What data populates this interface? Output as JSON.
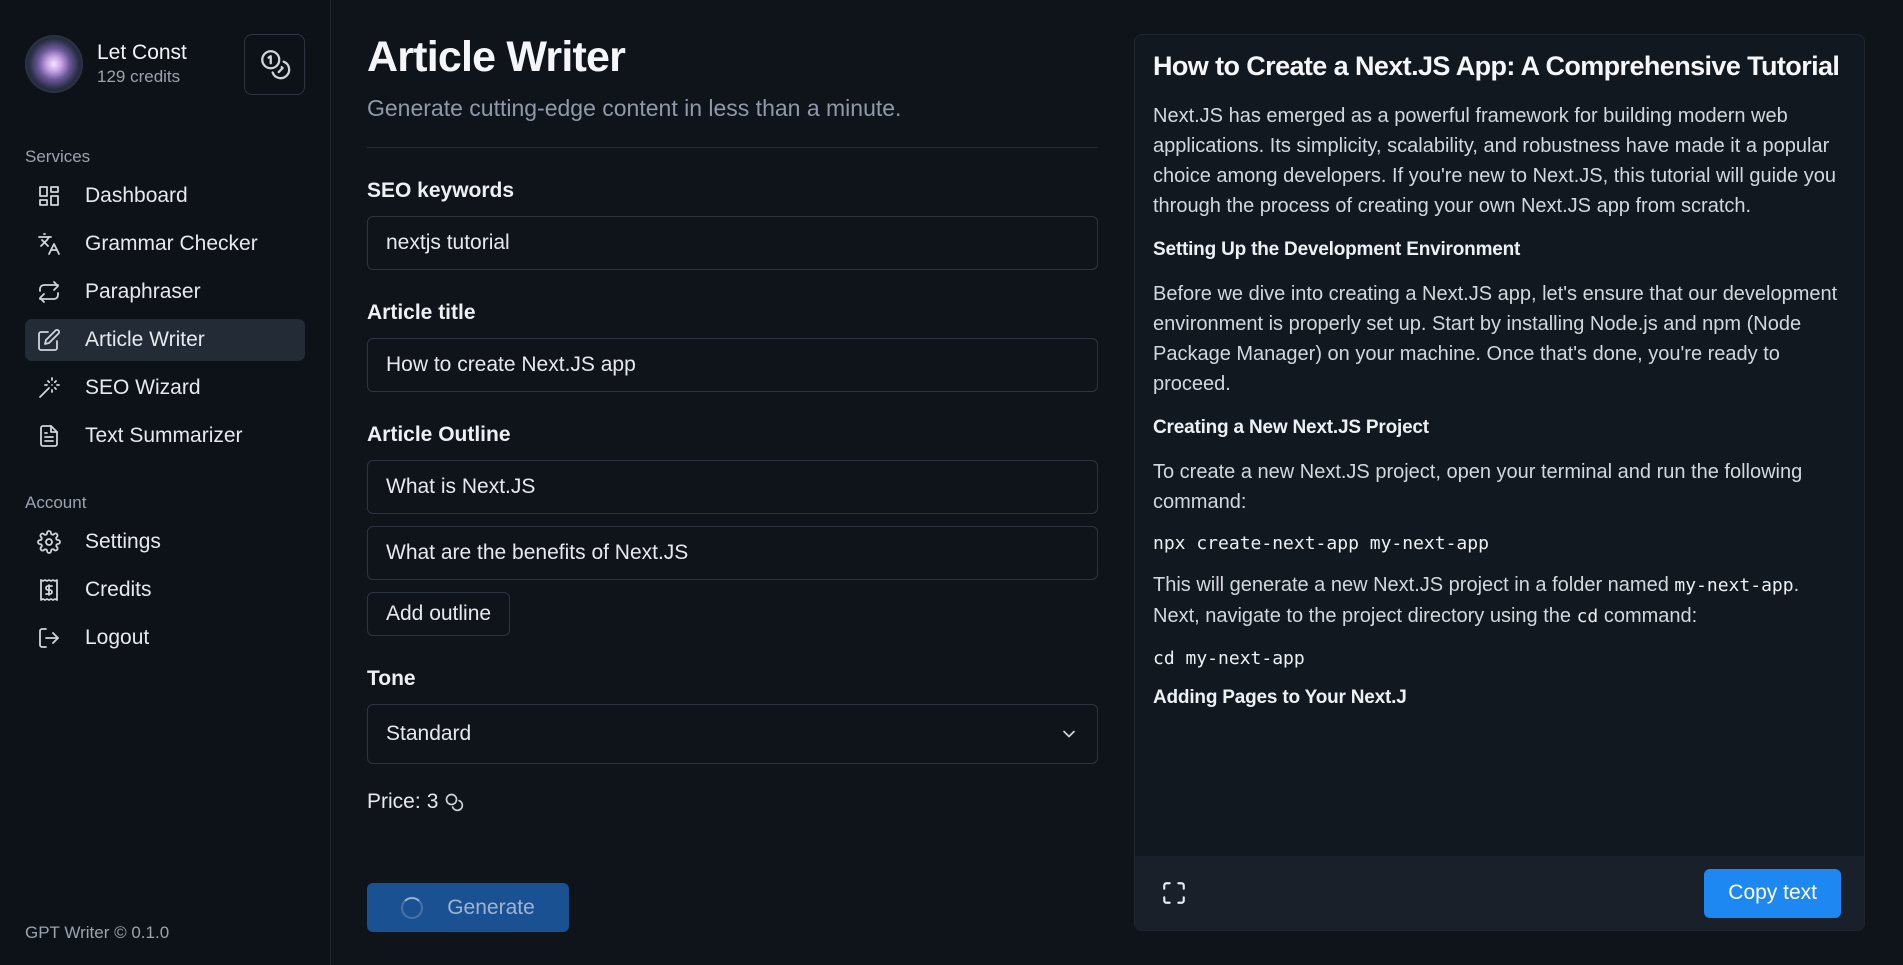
{
  "profile": {
    "name": "Let Const",
    "credits": "129 credits"
  },
  "sidebar": {
    "services_title": "Services",
    "services": [
      {
        "label": "Dashboard",
        "icon": "dashboard-icon"
      },
      {
        "label": "Grammar Checker",
        "icon": "translate-icon"
      },
      {
        "label": "Paraphraser",
        "icon": "repeat-icon"
      },
      {
        "label": "Article Writer",
        "icon": "edit-icon",
        "active": true
      },
      {
        "label": "SEO Wizard",
        "icon": "magic-wand-icon"
      },
      {
        "label": "Text Summarizer",
        "icon": "document-icon"
      }
    ],
    "account_title": "Account",
    "account": [
      {
        "label": "Settings",
        "icon": "gear-icon"
      },
      {
        "label": "Credits",
        "icon": "receipt-dollar-icon"
      },
      {
        "label": "Logout",
        "icon": "logout-icon"
      }
    ],
    "version": "GPT Writer © 0.1.0"
  },
  "main": {
    "title": "Article Writer",
    "subtitle": "Generate cutting-edge content in less than a minute.",
    "seo_label": "SEO keywords",
    "seo_value": "nextjs tutorial",
    "title_label": "Article title",
    "title_value": "How to create Next.JS app",
    "outline_label": "Article Outline",
    "outline": [
      "What is Next.JS",
      "What are the benefits of Next.JS"
    ],
    "add_outline_label": "Add outline",
    "tone_label": "Tone",
    "tone_value": "Standard",
    "price_label": "Price:",
    "price_value": "3",
    "generate_label": "Generate"
  },
  "article": {
    "title": "How to Create a Next.JS App: A Comprehensive Tutorial",
    "intro": "Next.JS has emerged as a powerful framework for building modern web applications. Its simplicity, scalability, and robustness have made it a popular choice among developers. If you're new to Next.JS, this tutorial will guide you through the process of creating your own Next.JS app from scratch.",
    "h_setup": "Setting Up the Development Environment",
    "p_setup": "Before we dive into creating a Next.JS app, let's ensure that our development environment is properly set up. Start by installing Node.js and npm (Node Package Manager) on your machine. Once that's done, you're ready to proceed.",
    "h_create": "Creating a New Next.JS Project",
    "p_create": "To create a new Next.JS project, open your terminal and run the following command:",
    "cmd_create": "npx create-next-app my-next-app",
    "p_gen_1": "This will generate a new Next.JS project in a folder named ",
    "p_gen_code1": "my-next-app",
    "p_gen_2": ". Next, navigate to the project directory using the ",
    "p_gen_code2": "cd",
    "p_gen_3": " command:",
    "cmd_cd": "cd my-next-app",
    "h_pages": "Adding Pages to Your Next.J",
    "copy_label": "Copy text"
  },
  "colors": {
    "accent": "#1e88f2",
    "generate_disabled": "#1a5193",
    "background": "#0f141b"
  }
}
